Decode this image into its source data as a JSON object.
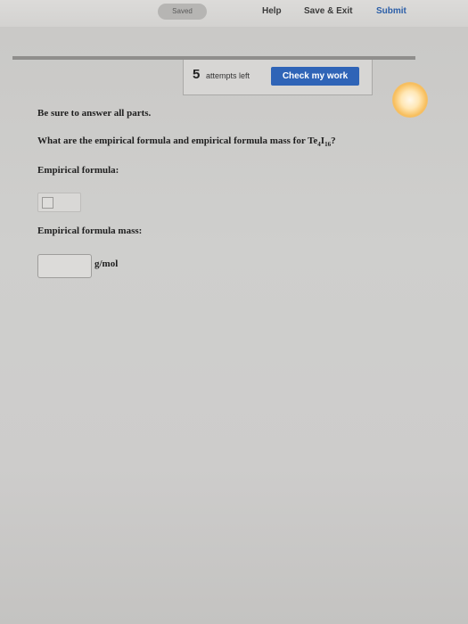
{
  "header": {
    "status": "Saved",
    "help_label": "Help",
    "save_exit_label": "Save & Exit",
    "submit_label": "Submit"
  },
  "attempts": {
    "count": "5",
    "label": "attempts left",
    "check_label": "Check my work"
  },
  "question": {
    "instructions": "Be sure to answer all parts.",
    "prompt_prefix": "What are the empirical formula and empirical formula mass for ",
    "formula_el1": "Te",
    "formula_sub1": "4",
    "formula_el2": "I",
    "formula_sub2": "16",
    "prompt_suffix": "?"
  },
  "answers": {
    "empirical_formula_label": "Empirical formula:",
    "empirical_mass_label": "Empirical formula mass:",
    "mass_unit": "g/mol"
  },
  "colors": {
    "accent": "#2f64b7",
    "submit": "#2c5fa8"
  }
}
